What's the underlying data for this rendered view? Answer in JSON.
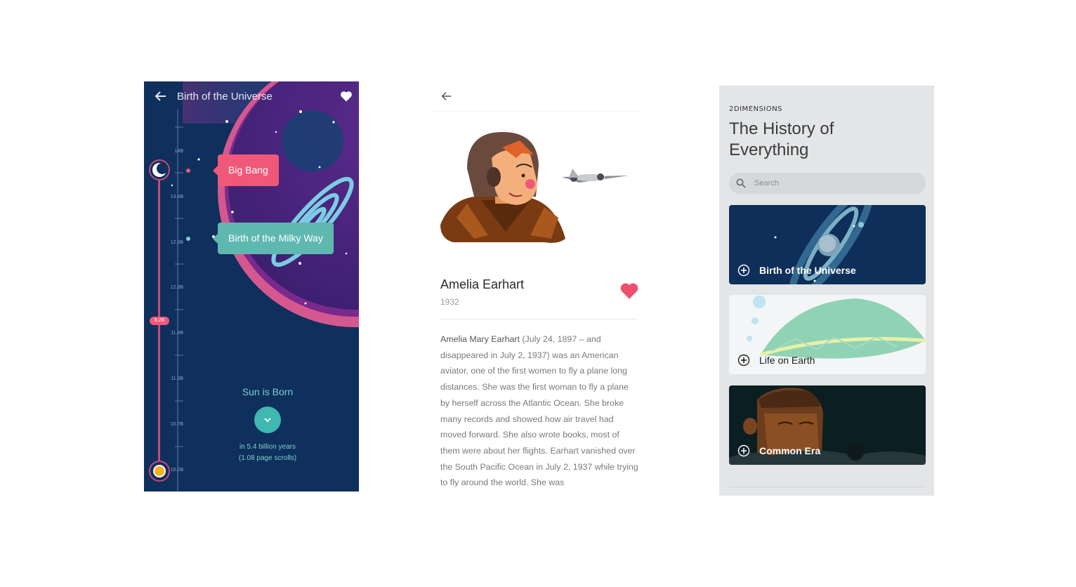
{
  "timeline_screen": {
    "title": "Birth of the Universe",
    "ticks": [
      "14B",
      "13.4B",
      "12.9B",
      "12.3B",
      "11.8B",
      "11.3B",
      "10.7B",
      "10.2B"
    ],
    "current_badge": "9.2B",
    "events": [
      {
        "label": "Big Bang",
        "color": "#f0587a"
      },
      {
        "label": "Birth of the Milky Way",
        "color": "#5fb8b0"
      }
    ],
    "next_event": {
      "title": "Sun is Born",
      "line1": "in 5.4 billion years",
      "line2": "(1.08 page scrolls)"
    },
    "icons": [
      "back-arrow-icon",
      "heart-icon",
      "chevron-down-icon"
    ]
  },
  "article_screen": {
    "name": "Amelia Earhart",
    "year": "1932",
    "body_bold": "Amelia Mary Earhart",
    "body_rest": " (July 24, 1897 – and disappeared in July 2, 1937) was an American aviator, one of the first women to fly a plane long distances. She was the first woman to fly a plane by herself across the Atlantic Ocean. She broke many records and showed how air travel had moved forward. She also wrote books, most of them were about her flights. Earhart vanished over the South Pacific Ocean in July 2, 1937 while trying to fly around the world. She was",
    "favorite_color": "#ef4f6c",
    "icons": [
      "back-arrow-icon",
      "heart-icon"
    ]
  },
  "menu_screen": {
    "brand": "2DIMENSIONS",
    "title": "The History of Everything",
    "search_placeholder": "Search",
    "cards": [
      {
        "label": "Birth of the Universe"
      },
      {
        "label": "Life on Earth"
      },
      {
        "label": "Common Era"
      }
    ],
    "icons": [
      "search-icon",
      "plus-circle-icon"
    ]
  },
  "colors": {
    "accent_pink": "#f0587a",
    "accent_teal": "#5fb8b0",
    "space_navy": "#0f2f5c"
  }
}
